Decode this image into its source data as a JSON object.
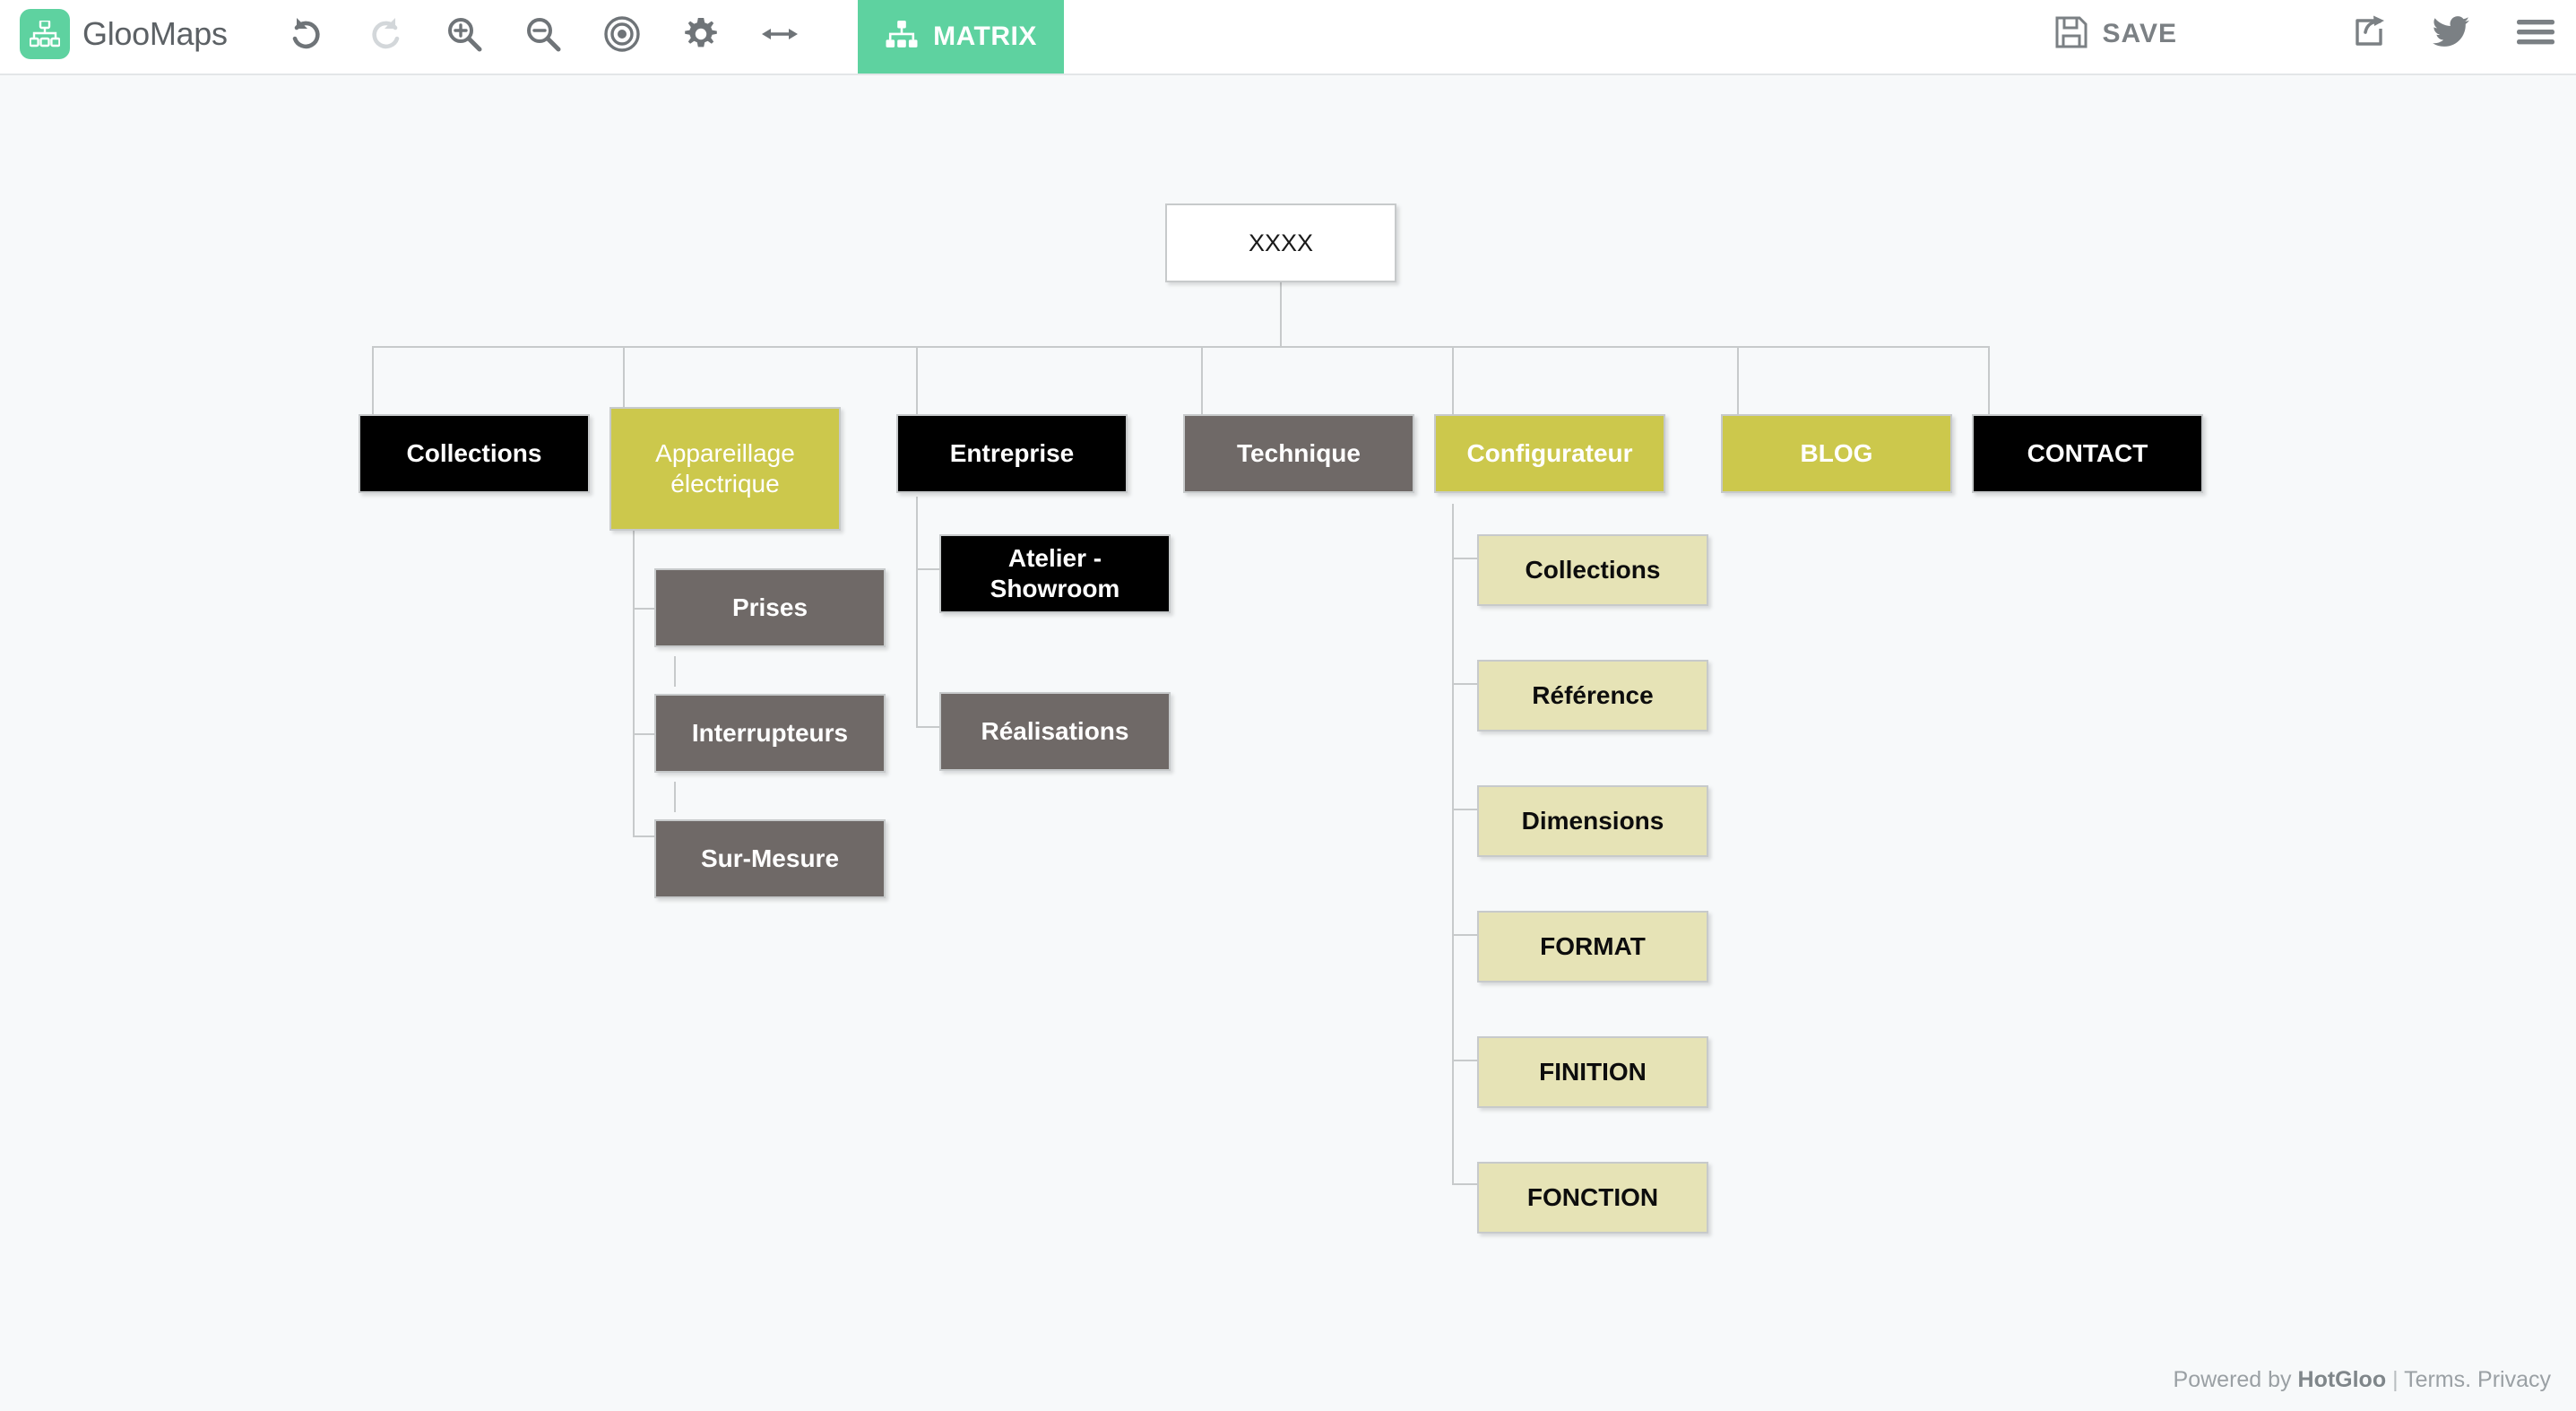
{
  "app": {
    "brand_name": "GlooMaps",
    "logo_icon": "sitemap-icon"
  },
  "toolbar": {
    "tools": [
      {
        "name": "undo-button",
        "icon": "undo-icon",
        "title": "Undo",
        "disabled": false
      },
      {
        "name": "redo-button",
        "icon": "redo-icon",
        "title": "Redo",
        "disabled": true
      },
      {
        "name": "zoom-in-button",
        "icon": "zoom-in-icon",
        "title": "Zoom in",
        "disabled": false
      },
      {
        "name": "zoom-out-button",
        "icon": "zoom-out-icon",
        "title": "Zoom out",
        "disabled": false
      },
      {
        "name": "center-button",
        "icon": "target-icon",
        "title": "Center",
        "disabled": false
      },
      {
        "name": "settings-button",
        "icon": "gear-icon",
        "title": "Settings",
        "disabled": false
      },
      {
        "name": "resize-button",
        "icon": "arrows-horizontal-icon",
        "title": "Fit width",
        "disabled": false
      }
    ],
    "matrix_label": "MATRIX",
    "matrix_icon": "sitemap-icon",
    "save_label": "SAVE",
    "save_icon": "floppy-disk-icon",
    "share_icon": "share-icon",
    "twitter_icon": "twitter-icon",
    "menu_icon": "hamburger-menu-icon"
  },
  "colors": {
    "accent": "#5ed2a0",
    "canvas": "#f7f9fa",
    "node_black": "#000000",
    "node_olive": "#ccc84c",
    "node_gray": "#6f6967",
    "node_khaki": "#e6e3b6",
    "node_white": "#ffffff",
    "edge": "#c7cacb"
  },
  "sitemap": {
    "root": {
      "label": "XXXX",
      "style": "root"
    },
    "level1": [
      {
        "label": "Collections",
        "style": "black"
      },
      {
        "label": "Appareillage électrique",
        "style": "olive"
      },
      {
        "label": "Entreprise",
        "style": "black"
      },
      {
        "label": "Technique",
        "style": "gray"
      },
      {
        "label": "Configurateur",
        "style": "olive-bold"
      },
      {
        "label": "BLOG",
        "style": "olive-bold"
      },
      {
        "label": "CONTACT",
        "style": "black"
      }
    ],
    "appareillage_children": [
      {
        "label": "Prises",
        "style": "gray"
      },
      {
        "label": "Interrupteurs",
        "style": "gray"
      },
      {
        "label": "Sur-Mesure",
        "style": "gray"
      }
    ],
    "entreprise_children": [
      {
        "label": "Atelier - Showroom",
        "style": "black"
      },
      {
        "label": "Réalisations",
        "style": "gray"
      }
    ],
    "configurateur_children": [
      {
        "label": "Collections",
        "style": "khaki"
      },
      {
        "label": "Référence",
        "style": "khaki"
      },
      {
        "label": "Dimensions",
        "style": "khaki"
      },
      {
        "label": "FORMAT",
        "style": "khaki"
      },
      {
        "label": "FINITION",
        "style": "khaki"
      },
      {
        "label": "FONCTION",
        "style": "khaki"
      }
    ]
  },
  "footer": {
    "powered_by": "Powered by",
    "company": "HotGloo",
    "separator": "|",
    "terms": "Terms",
    "dot": ".",
    "privacy": "Privacy"
  }
}
